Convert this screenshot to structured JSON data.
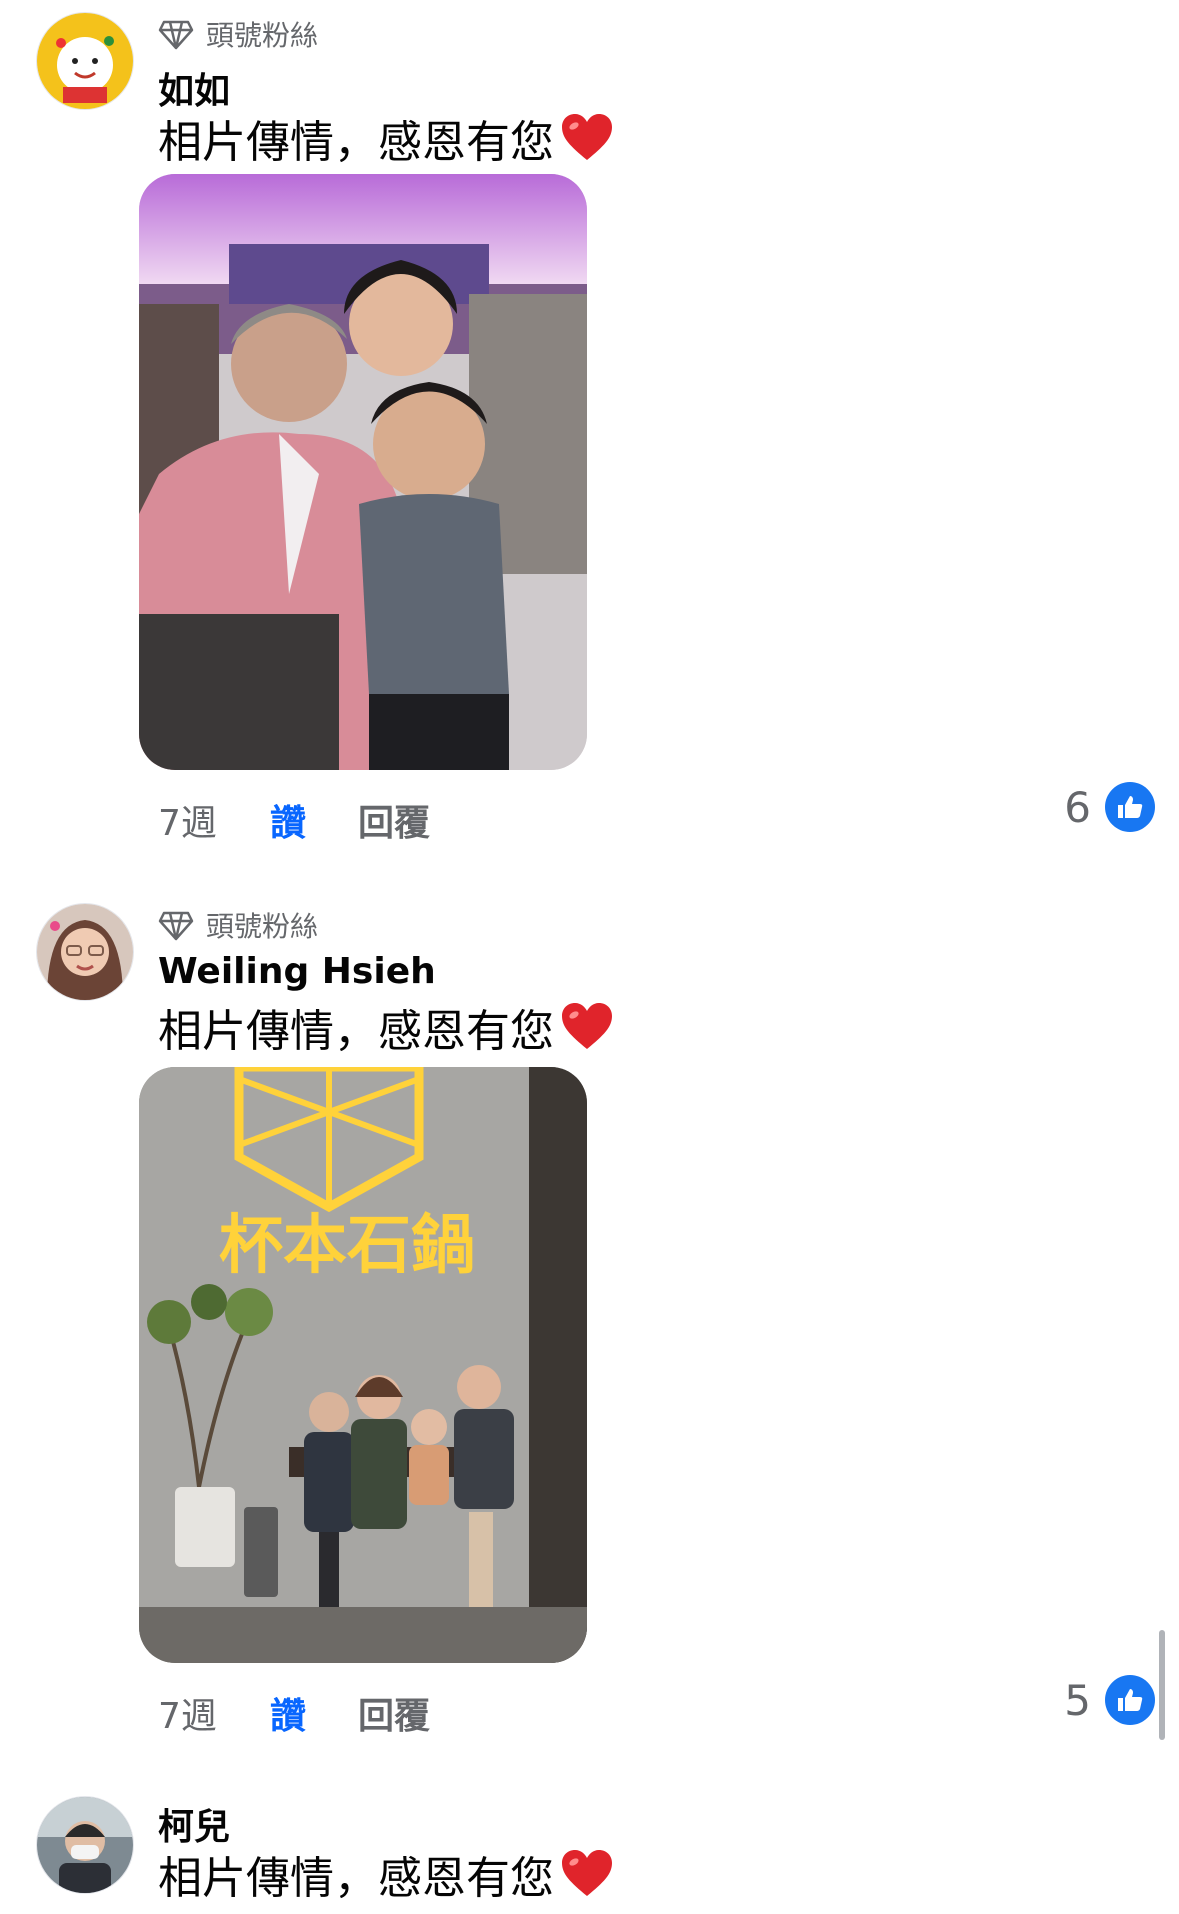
{
  "comments": [
    {
      "badge": "頭號粉絲",
      "author": "如如",
      "text": "相片傳情，感恩有您",
      "time": "7週",
      "like_label": "讚",
      "reply_label": "回覆",
      "reaction_count": "6"
    },
    {
      "badge": "頭號粉絲",
      "author": "Weiling Hsieh",
      "text": "相片傳情，感恩有您",
      "time": "7週",
      "like_label": "讚",
      "reply_label": "回覆",
      "reaction_count": "5",
      "sign_text": "杯本石鍋"
    },
    {
      "author": "柯兒",
      "text": "相片傳情，感恩有您"
    }
  ],
  "colors": {
    "accent": "#0866ff",
    "like_badge": "#1877f2",
    "muted_text": "#65676b",
    "heart": "#e0242b"
  },
  "icons": [
    "diamond-icon",
    "heart-icon",
    "thumbs-up-icon"
  ]
}
